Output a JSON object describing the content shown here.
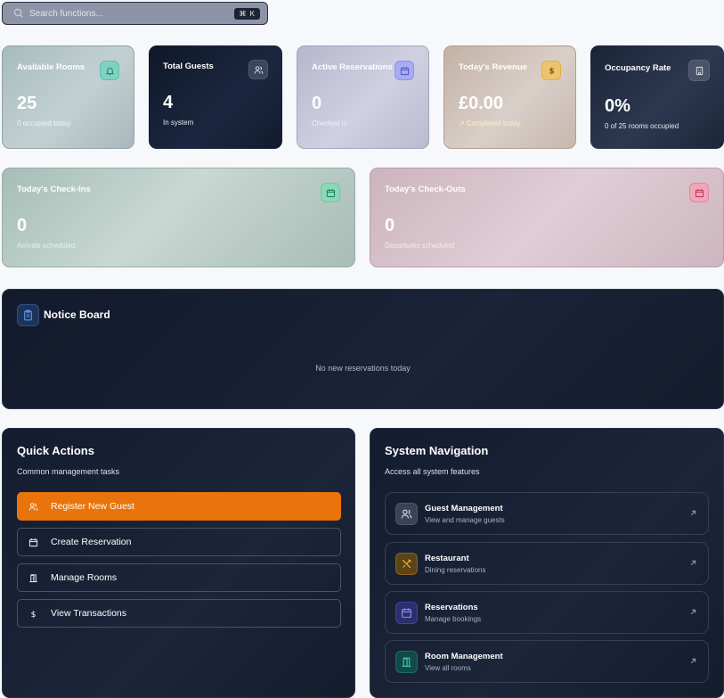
{
  "search": {
    "placeholder": "Search functions...",
    "shortcut": "⌘ K"
  },
  "stats": {
    "available_rooms": {
      "title": "Available Rooms",
      "value": "25",
      "sub": "0 occupied today",
      "sub_color": "#e9f6ff",
      "icon": "bell-icon"
    },
    "total_guests": {
      "title": "Total Guests",
      "value": "4",
      "sub": "In system",
      "sub_color": "#e7eaf1",
      "icon": "users-icon"
    },
    "active_reservations": {
      "title": "Active Reservations",
      "value": "0",
      "sub": "Checked in",
      "sub_color": "#eef0ff",
      "icon": "calendar-icon"
    },
    "todays_revenue": {
      "title": "Today's Revenue",
      "value": "£0.00",
      "sub": "↗ Completed today",
      "sub_color": "#fdf0c6",
      "icon": "dollar-icon"
    },
    "occupancy_rate": {
      "title": "Occupancy Rate",
      "value": "0%",
      "sub": "0 of 25 rooms occupied",
      "sub_color": "#e7eaf1",
      "icon": "building-icon"
    },
    "checkins": {
      "title": "Today's Check-Ins",
      "value": "0",
      "sub": "Arrivals scheduled",
      "sub_color": "#d6fbe6",
      "icon": "calendar-icon"
    },
    "checkouts": {
      "title": "Today's Check-Outs",
      "value": "0",
      "sub": "Departures scheduled",
      "sub_color": "#fde6ec",
      "icon": "calendar-icon"
    }
  },
  "notice": {
    "title": "Notice Board",
    "empty": "No new reservations today"
  },
  "quick_actions": {
    "title": "Quick Actions",
    "subtitle": "Common management tasks",
    "items": [
      {
        "label": "Register New Guest",
        "icon": "users-icon"
      },
      {
        "label": "Create Reservation",
        "icon": "calendar-icon"
      },
      {
        "label": "Manage Rooms",
        "icon": "door-icon"
      },
      {
        "label": "View Transactions",
        "icon": "dollar-icon"
      }
    ]
  },
  "system_nav": {
    "title": "System Navigation",
    "subtitle": "Access all system features",
    "items": [
      {
        "title": "Guest Management",
        "sub": "View and manage guests",
        "icon": "users-icon"
      },
      {
        "title": "Restaurant",
        "sub": "Dining reservations",
        "icon": "utensils-icon"
      },
      {
        "title": "Reservations",
        "sub": "Manage bookings",
        "icon": "calendar-icon"
      },
      {
        "title": "Room Management",
        "sub": "View all rooms",
        "icon": "door-icon"
      }
    ]
  },
  "colors": {
    "accent_orange": "#e8740b",
    "dark_panel": "#141c2f",
    "teal": "#2fbf9f",
    "indigo": "#6f73e8",
    "amber": "#e3a42c",
    "rose": "#e25a7d"
  }
}
